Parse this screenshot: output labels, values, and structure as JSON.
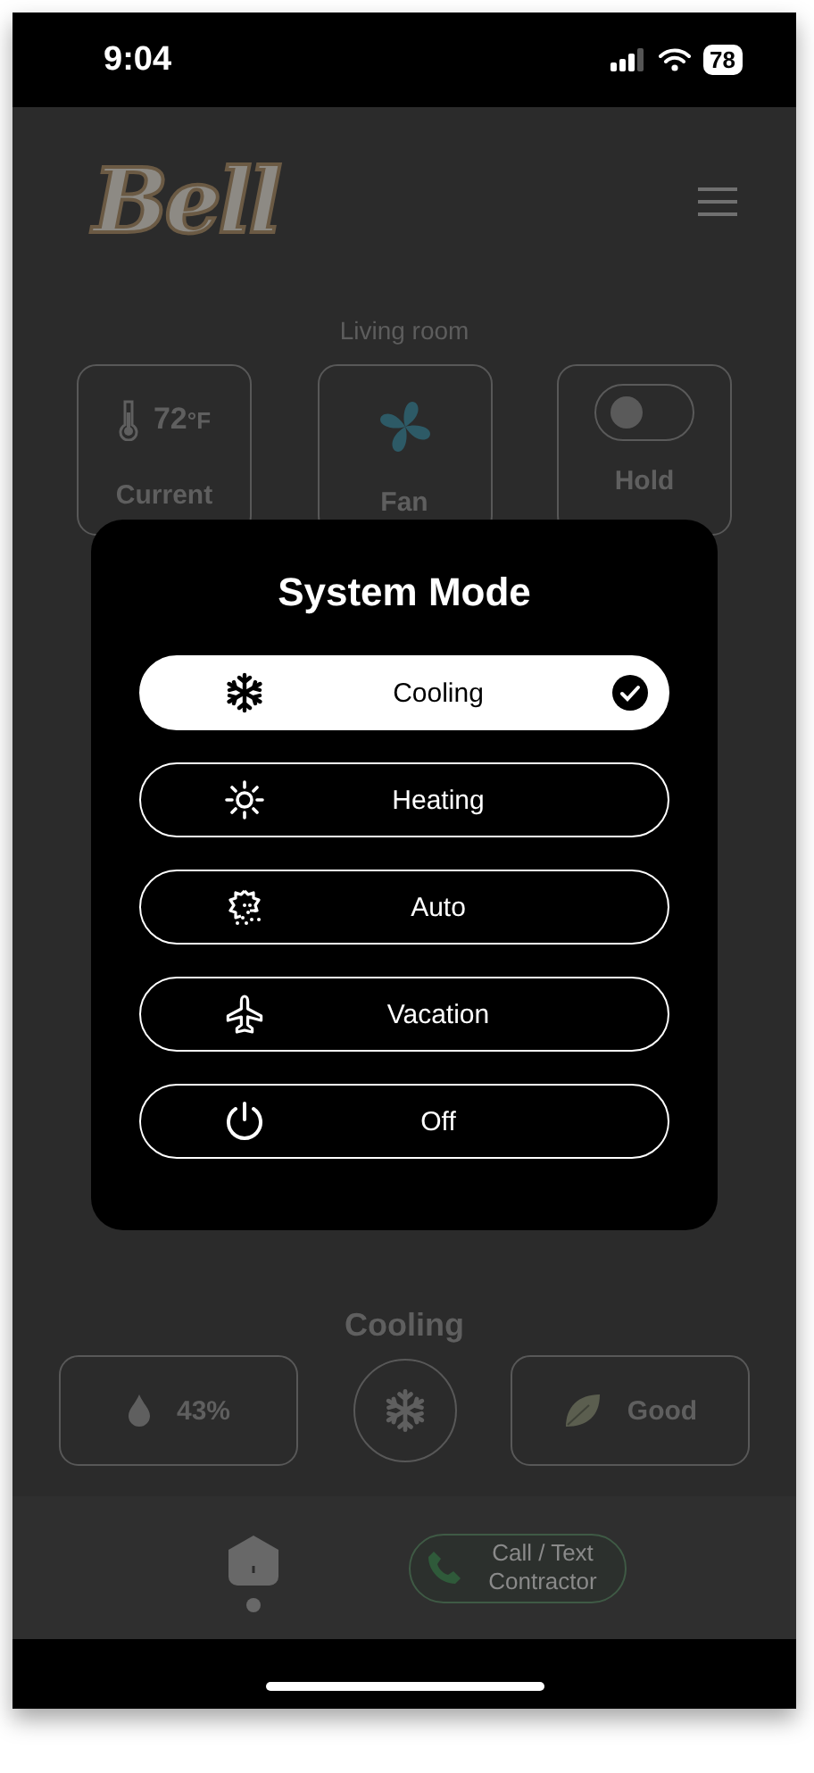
{
  "status_bar": {
    "time": "9:04",
    "battery": "78"
  },
  "header": {
    "logo": "Bell"
  },
  "room": "Living room",
  "tiles": [
    {
      "kind": "temperature",
      "value": "72",
      "unit": "°F",
      "label": "Current"
    },
    {
      "kind": "fan",
      "label": "Fan"
    },
    {
      "kind": "toggle",
      "label": "Hold",
      "on": false
    }
  ],
  "modal": {
    "title": "System Mode",
    "options": [
      {
        "kind": "cooling",
        "label": "Cooling",
        "selected": true
      },
      {
        "kind": "heating",
        "label": "Heating",
        "selected": false
      },
      {
        "kind": "auto",
        "label": "Auto",
        "selected": false
      },
      {
        "kind": "vacation",
        "label": "Vacation",
        "selected": false
      },
      {
        "kind": "off",
        "label": "Off",
        "selected": false
      }
    ]
  },
  "mode_label": "Cooling",
  "stats": [
    {
      "kind": "humidity",
      "value": "43%"
    },
    {
      "kind": "mode"
    },
    {
      "kind": "air",
      "value": "Good"
    }
  ],
  "nav": [
    {
      "kind": "home",
      "selected": true
    },
    {
      "kind": "contact",
      "label": "Call / Text Contractor"
    }
  ]
}
